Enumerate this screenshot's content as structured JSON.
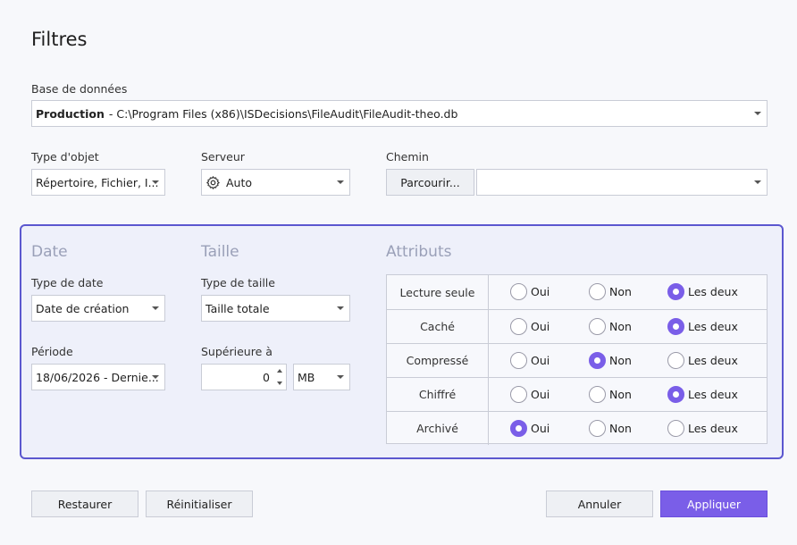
{
  "title": "Filtres",
  "database": {
    "label": "Base de données",
    "name": "Production",
    "path": "- C:\\Program Files (x86)\\ISDecisions\\FileAudit\\FileAudit-theo.db"
  },
  "object_type": {
    "label": "Type d'objet",
    "value": "Répertoire, Fichier, I..."
  },
  "server": {
    "label": "Serveur",
    "value": "Auto"
  },
  "path_filter": {
    "label": "Chemin",
    "browse": "Parcourir...",
    "value": ""
  },
  "date": {
    "section": "Date",
    "type_label": "Type de date",
    "type_value": "Date de création",
    "period_label": "Période",
    "period_value": "18/06/2026 - Dernie..."
  },
  "size": {
    "section": "Taille",
    "type_label": "Type de taille",
    "type_value": "Taille totale",
    "greater_label": "Supérieure à",
    "greater_value": "0",
    "unit": "MB"
  },
  "attributes": {
    "section": "Attributs",
    "options": [
      "Oui",
      "Non",
      "Les deux"
    ],
    "rows": [
      {
        "label": "Lecture seule",
        "selected": "Les deux"
      },
      {
        "label": "Caché",
        "selected": "Les deux"
      },
      {
        "label": "Compressé",
        "selected": "Non"
      },
      {
        "label": "Chiffré",
        "selected": "Les deux"
      },
      {
        "label": "Archivé",
        "selected": "Oui"
      }
    ]
  },
  "buttons": {
    "restore": "Restaurer",
    "reset": "Réinitialiser",
    "cancel": "Annuler",
    "apply": "Appliquer"
  },
  "colors": {
    "accent": "#7a5ee8",
    "panel_border": "#5b57cf"
  }
}
